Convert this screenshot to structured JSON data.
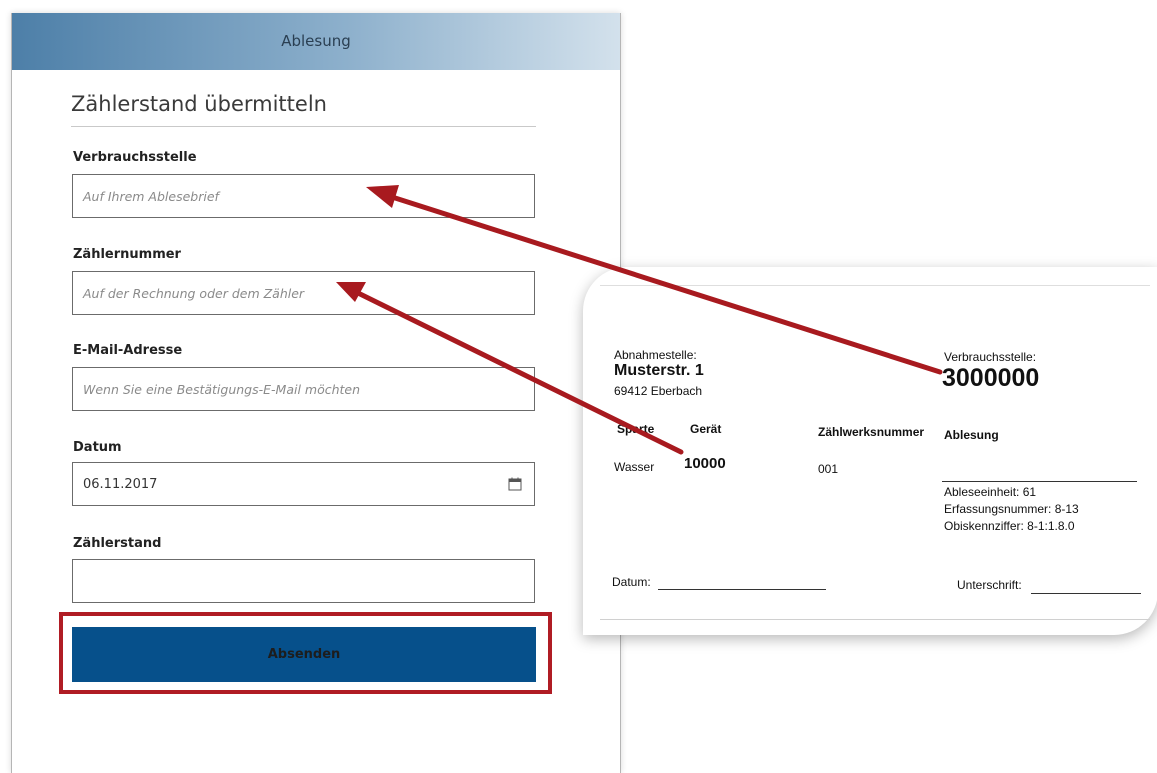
{
  "header": {
    "title": "Ablesung"
  },
  "form": {
    "title": "Zählerstand übermitteln",
    "fields": [
      {
        "label": "Verbrauchsstelle",
        "placeholder": "Auf Ihrem Ablesebrief",
        "value": ""
      },
      {
        "label": "Zählernummer",
        "placeholder": "Auf der Rechnung oder dem Zähler",
        "value": ""
      },
      {
        "label": "E-Mail-Adresse",
        "placeholder": "Wenn Sie eine Bestätigungs-E-Mail möchten",
        "value": ""
      },
      {
        "label": "Datum",
        "placeholder": "",
        "value": "06.11.2017"
      },
      {
        "label": "Zählerstand",
        "placeholder": "",
        "value": ""
      }
    ],
    "submit_label": "Absenden"
  },
  "card": {
    "abnahmestelle_label": "Abnahmestelle:",
    "street": "Musterstr. 1",
    "city": "69412 Eberbach",
    "verbrauchsstelle_label": "Verbrauchsstelle:",
    "verbrauchsstelle_value": "3000000",
    "col_sparte": "Sparte",
    "col_geraet": "Gerät",
    "col_zaehlwerksnummer": "Zählwerksnummer",
    "col_ablesung": "Ablesung",
    "row_sparte": "Wasser",
    "row_geraet": "10000",
    "row_zaehlwerk": "001",
    "ableseeinheit": "Ableseeinheit: 61",
    "erfassungsnummer": "Erfassungsnummer: 8-13",
    "obiskennziffer": "Obiskennziffer: 8-1:1.8.0",
    "datum_label": "Datum:",
    "unterschrift_label": "Unterschrift:"
  },
  "colors": {
    "header_start": "#4d7fa8",
    "button": "#06508b",
    "highlight": "#b01c24",
    "arrow": "#a81a1f"
  },
  "icons": {
    "date_field": "calendar-icon"
  }
}
